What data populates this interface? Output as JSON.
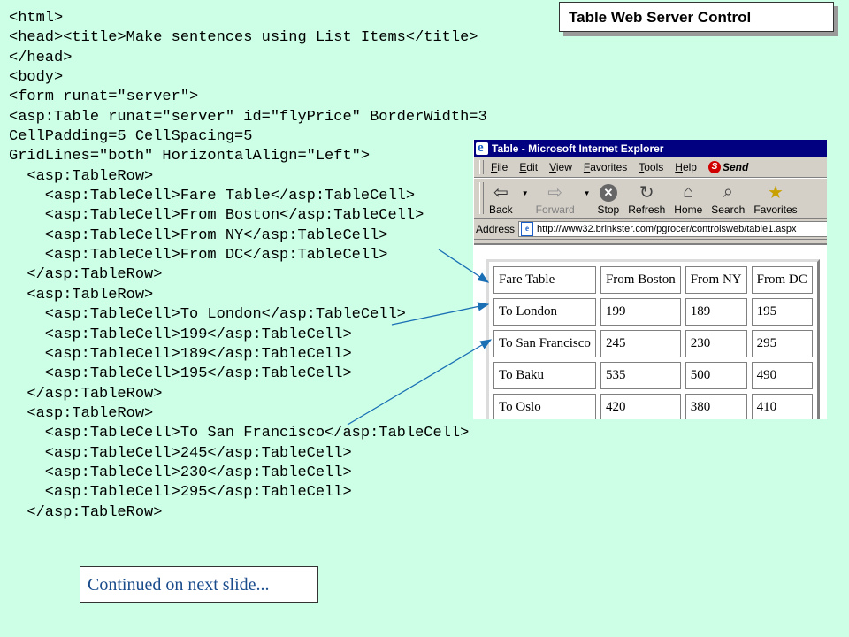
{
  "slide_title": "Table Web Server Control",
  "continued_label": "Continued on next slide...",
  "code_lines": [
    "<html>",
    "<head><title>Make sentences using List Items</title>",
    "</head>",
    "<body>",
    "<form runat=\"server\">",
    "<asp:Table runat=\"server\" id=\"flyPrice\" BorderWidth=3",
    "CellPadding=5 CellSpacing=5",
    "GridLines=\"both\" HorizontalAlign=\"Left\">",
    "  <asp:TableRow>",
    "    <asp:TableCell>Fare Table</asp:TableCell>",
    "    <asp:TableCell>From Boston</asp:TableCell>",
    "    <asp:TableCell>From NY</asp:TableCell>",
    "    <asp:TableCell>From DC</asp:TableCell>",
    "  </asp:TableRow>",
    "  <asp:TableRow>",
    "    <asp:TableCell>To London</asp:TableCell>",
    "    <asp:TableCell>199</asp:TableCell>",
    "    <asp:TableCell>189</asp:TableCell>",
    "    <asp:TableCell>195</asp:TableCell>",
    "  </asp:TableRow>",
    "  <asp:TableRow>",
    "    <asp:TableCell>To San Francisco</asp:TableCell>",
    "    <asp:TableCell>245</asp:TableCell>",
    "    <asp:TableCell>230</asp:TableCell>",
    "    <asp:TableCell>295</asp:TableCell>",
    "  </asp:TableRow>"
  ],
  "browser": {
    "title": "Table - Microsoft Internet Explorer",
    "menu": [
      "File",
      "Edit",
      "View",
      "Favorites",
      "Tools",
      "Help"
    ],
    "send_label": "Send",
    "toolbar": [
      {
        "label": "Back",
        "icon": "back-arrow-icon",
        "enabled": true
      },
      {
        "label": "Forward",
        "icon": "forward-arrow-icon",
        "enabled": false
      },
      {
        "label": "Stop",
        "icon": "stop-icon",
        "enabled": true
      },
      {
        "label": "Refresh",
        "icon": "refresh-icon",
        "enabled": true
      },
      {
        "label": "Home",
        "icon": "home-icon",
        "enabled": true
      },
      {
        "label": "Search",
        "icon": "search-icon",
        "enabled": true
      },
      {
        "label": "Favorites",
        "icon": "favorites-icon",
        "enabled": true
      }
    ],
    "address_label": "Address",
    "address_url": "http://www32.brinkster.com/pgrocer/controlsweb/table1.aspx"
  },
  "fare_table": [
    [
      "Fare Table",
      "From Boston",
      "From NY",
      "From DC"
    ],
    [
      "To London",
      "199",
      "189",
      "195"
    ],
    [
      "To San Francisco",
      "245",
      "230",
      "295"
    ],
    [
      "To Baku",
      "535",
      "500",
      "490"
    ],
    [
      "To Oslo",
      "420",
      "380",
      "410"
    ]
  ],
  "colors": {
    "background": "#ccffe6",
    "titlebar": "#000080",
    "continued_text": "#1a4c8c",
    "arrow": "#1a6fb5"
  }
}
